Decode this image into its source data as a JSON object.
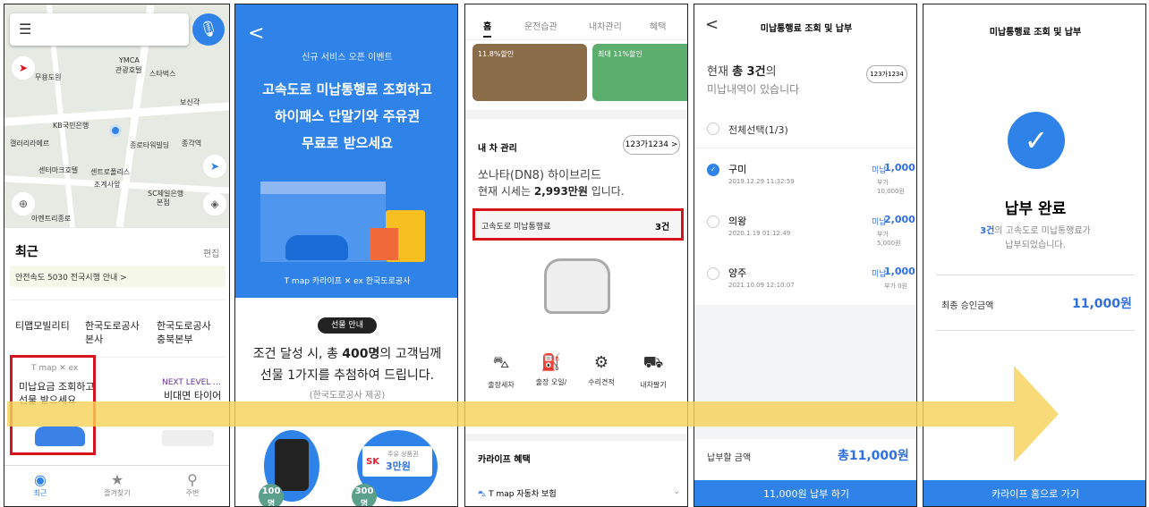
{
  "s1": {
    "menu_icon": "menu-icon",
    "mic_label": "음성검색",
    "poi": [
      "YMCA",
      "관광호텔",
      "무용도원",
      "스타벅스",
      "보신각",
      "KB국민은행",
      "갤러리라메르",
      "종로타워빌딩",
      "종각역",
      "센터마크호텔",
      "센트로폴리스",
      "조계사앞",
      "SC제일은행",
      "본점",
      "아멘트리종로"
    ],
    "recent_title": "최근",
    "edit": "편집",
    "notice": "안전속도 5030 전국시행 안내 >",
    "tiles": [
      "티맵모빌리티",
      "한국도로공사\n본사",
      "한국도로공사\n충북본부",
      "미납요금 조회하고\n선물 받으세요",
      "",
      "비대면 타이어"
    ],
    "tile_brand": "T map ✕ ex",
    "next_level": "NEXT LEVEL ...",
    "nav": [
      "최근",
      "즐겨찾기",
      "주변"
    ]
  },
  "s2": {
    "back": "<",
    "event": "신규 서비스 오픈 이벤트",
    "headline": [
      "고속도로 미납통행료 조회하고",
      "하이패스 단말기와 주유권",
      "무료로 받으세요"
    ],
    "brand": "T map 카라이프 ✕ ex 한국도로공사",
    "gift_badge": "선물 안내",
    "desc1": "조건 달성 시, 총 ",
    "desc_bold": "400명",
    "desc2": "의 고객님께",
    "desc3": "선물 1가지를 추첨하여 드립니다.",
    "desc4": "(한국도로공사 제공)",
    "badge1": "100",
    "badge1_unit": "명",
    "badge2": "300",
    "badge2_unit": "명",
    "sk": "SK",
    "voucher": "3만원",
    "voucher_note": "주유 상품권"
  },
  "s3": {
    "tabs": [
      "홈",
      "운전습관",
      "내차관리",
      "혜택"
    ],
    "card1": "11.8%할인",
    "card2": "최대 11%할인",
    "section": "내 차 관리",
    "plate": "123가1234 >",
    "car": "쏘나타(DN8) 하이브리드",
    "price_pre": "현재 시세는 ",
    "price": "2,993만원",
    "price_post": " 입니다.",
    "toll_label": "고속도로 미납통행료",
    "toll_value": "3건",
    "icons": [
      "출장세차",
      "출장 오일/",
      "수리견적",
      "내차팔기"
    ],
    "benefit": "카라이프 혜택",
    "insurance": "T map 자동차 보험"
  },
  "s4": {
    "back": "<",
    "title": "미납통행료 조회 및 납부",
    "h1a": "현재 ",
    "h1b": "총 3건",
    "h1c": "의",
    "h2": "미납내역이 있습니다",
    "plate": "123가1234",
    "select_all": "전체선택(1/3)",
    "items": [
      {
        "name": "구미",
        "date": "2019.12.29 11:32:59",
        "tag": "미납",
        "amt": "1,000",
        "fee": "부가 10,000원"
      },
      {
        "name": "의왕",
        "date": "2020.1.19 01:12:49",
        "tag": "미납",
        "amt": "2,000",
        "fee": "부가 5,000원"
      },
      {
        "name": "양주",
        "date": "2021.10.09 12:10:07",
        "tag": "미납",
        "amt": "1,000",
        "fee": "부가 0원"
      }
    ],
    "pay_label": "납부할 금액",
    "pay_amt": "총11,000원",
    "btn": "11,000원 납부 하기"
  },
  "s5": {
    "title": "미납통행료 조회 및 납부",
    "done": "납부 완료",
    "msg1a": "3건",
    "msg1b": "의 고속도로 미납통행료가",
    "msg2": "납부되었습니다.",
    "approve_label": "최종 승인금액",
    "approve_amt": "11,000원",
    "btn": "카라이프 홈으로 가기"
  },
  "colors": {
    "accent": "#2f83e8",
    "highlight": "#d6141c",
    "arrow": "#f8d25a"
  }
}
